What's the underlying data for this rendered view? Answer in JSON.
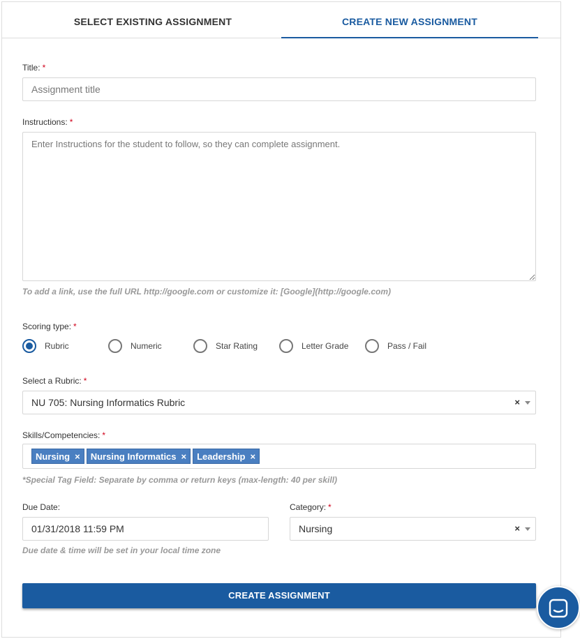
{
  "tabs": [
    {
      "label": "SELECT EXISTING ASSIGNMENT",
      "active": false
    },
    {
      "label": "CREATE NEW ASSIGNMENT",
      "active": true
    }
  ],
  "form": {
    "title": {
      "label": "Title:",
      "required_mark": "*",
      "value": "",
      "placeholder": "Assignment title"
    },
    "instructions": {
      "label": "Instructions:",
      "required_mark": "*",
      "value": "",
      "placeholder": "Enter Instructions for the student to follow, so they can complete assignment.",
      "hint": "To add a link, use the full URL http://google.com or customize it: [Google](http://google.com)"
    },
    "scoring": {
      "label": "Scoring type:",
      "required_mark": "*",
      "options": [
        "Rubric",
        "Numeric",
        "Star Rating",
        "Letter Grade",
        "Pass / Fail"
      ],
      "selected": "Rubric"
    },
    "rubric": {
      "label": "Select a Rubric:",
      "required_mark": "*",
      "value": "NU 705: Nursing Informatics Rubric",
      "clear": "×"
    },
    "skills": {
      "label": "Skills/Competencies:",
      "required_mark": "*",
      "tags": [
        "Nursing",
        "Nursing Informatics",
        "Leadership"
      ],
      "remove_glyph": "×",
      "hint": "*Special Tag Field: Separate by comma or return keys (max-length: 40 per skill)"
    },
    "due_date": {
      "label": "Due Date:",
      "value": "01/31/2018 11:59 PM",
      "hint": "Due date & time will be set in your local time zone"
    },
    "category": {
      "label": "Category:",
      "required_mark": "*",
      "value": "Nursing",
      "clear": "×"
    },
    "submit_label": "CREATE ASSIGNMENT"
  },
  "colors": {
    "accent": "#1a5ba0",
    "tag": "#4a7fc1",
    "required": "#d0021b"
  },
  "chat": {
    "icon": "chat-icon"
  }
}
